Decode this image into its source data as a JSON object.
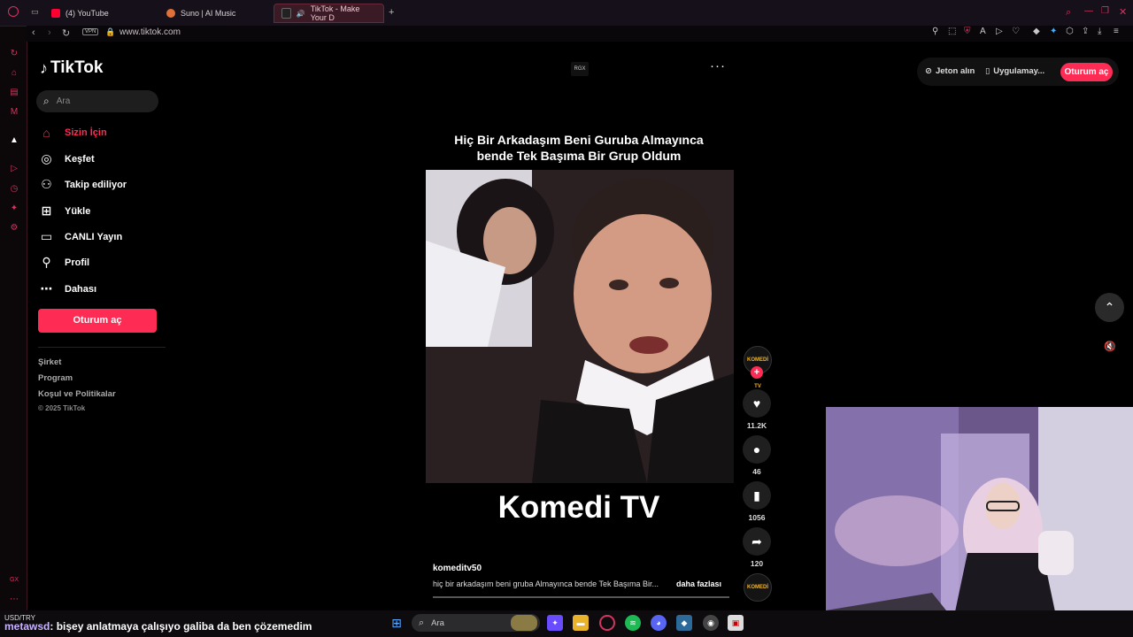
{
  "browser": {
    "tabs": [
      {
        "label": "(4) YouTube"
      },
      {
        "label": "Suno | AI Music"
      },
      {
        "label": "TikTok - Make Your D"
      }
    ],
    "new_tab": "+",
    "url": "www.tiktok.com",
    "vpn": "VPN"
  },
  "sidebar": {
    "logo": "TikTok",
    "search_placeholder": "Ara",
    "items": [
      {
        "label": "Sizin İçin",
        "icon": "home-icon"
      },
      {
        "label": "Keşfet",
        "icon": "compass-icon"
      },
      {
        "label": "Takip ediliyor",
        "icon": "following-icon"
      },
      {
        "label": "Yükle",
        "icon": "upload-icon"
      },
      {
        "label": "CANLI Yayın",
        "icon": "live-icon"
      },
      {
        "label": "Profil",
        "icon": "profile-icon"
      },
      {
        "label": "Dahası",
        "icon": "more-icon"
      }
    ],
    "login": "Oturum aç",
    "footer": [
      "Şirket",
      "Program",
      "Koşul ve Politikalar"
    ],
    "copyright": "© 2025 TikTok"
  },
  "topbar": {
    "coins": "Jeton alın",
    "app": "Uygulamay...",
    "login": "Oturum aç"
  },
  "video": {
    "badge": "RGX",
    "caption_line1": "Hiç Bir Arkadaşım Beni Guruba Almayınca",
    "caption_line2": "bende Tek Başıma Bir Grup Oldum",
    "overlay_text": "Komedi TV",
    "author": "komeditv50",
    "description": "hiç bir arkadaşım beni gruba Almayınca bende Tek Başıma Bir...",
    "more": "daha fazlası",
    "avatar_text": "KOMEDİ TV"
  },
  "actions": {
    "likes": "11.2K",
    "comments": "46",
    "saves": "1056",
    "shares": "120"
  },
  "stream": {
    "ticker": "USD/TRY",
    "chat_user": "metawsd",
    "chat_message": ": bişey anlatmaya çalışıyo galiba da ben çözemedim"
  },
  "taskbar": {
    "search": "Ara"
  },
  "colors": {
    "accent": "#fe2c55",
    "opera_red": "#d6345f"
  }
}
